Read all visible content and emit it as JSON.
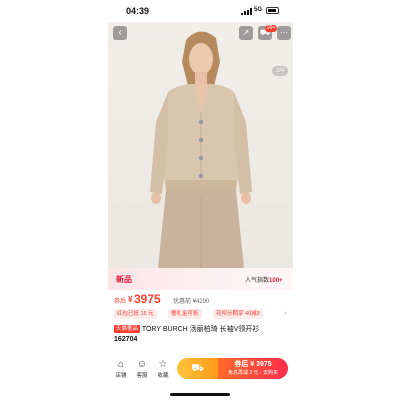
{
  "status_bar": {
    "time": "04:39",
    "network": "5G"
  },
  "gallery": {
    "counter": "2/4",
    "cart_badge": "99+"
  },
  "strip": {
    "new_label": "新品",
    "popularity_label": "人气指数",
    "popularity_value": "100+"
  },
  "price": {
    "label": "券后",
    "currency": "¥",
    "amount": "3975",
    "original": "优惠前 ¥4290"
  },
  "coupons": [
    {
      "label": "红包已抵 15 元"
    },
    {
      "label": "奢礼金可抵"
    },
    {
      "label": "花呗分期享 40减3"
    }
  ],
  "title": {
    "tag": "天猫奢品",
    "text": " TORY BURCH 汤丽柏琦 长袖V领开衫",
    "sku": "162704"
  },
  "bottom_bar": {
    "items": [
      {
        "icon": "store-icon",
        "label": "店铺"
      },
      {
        "icon": "chat-icon",
        "label": "客服"
      },
      {
        "icon": "star-icon",
        "label": "收藏"
      }
    ],
    "buy": {
      "line1": "券后 ¥ 3975",
      "line2": "免息再减 3 元 · 去购买"
    }
  },
  "colors": {
    "brand_red": "#ff3d2e",
    "cart_orange": "#ffb02e",
    "sweater": "#d9c6ae",
    "trousers": "#c9b39c"
  }
}
